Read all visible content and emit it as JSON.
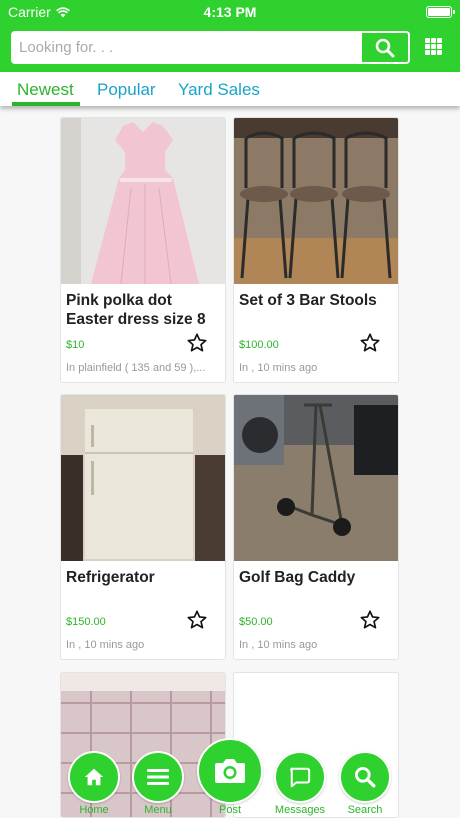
{
  "status_bar": {
    "carrier": "Carrier",
    "time": "4:13 PM"
  },
  "search": {
    "placeholder": "Looking for. . ."
  },
  "tabs": [
    {
      "label": "Newest",
      "active": true
    },
    {
      "label": "Popular",
      "active": false
    },
    {
      "label": "Yard Sales",
      "active": false
    }
  ],
  "listings": [
    {
      "title": "Pink polka dot Easter dress size 8",
      "price": "$10",
      "location": "In plainfield ( 135 and 59 ),..."
    },
    {
      "title": "Set of 3 Bar Stools",
      "price": "$100.00",
      "location": "In , 10 mins ago"
    },
    {
      "title": "Refrigerator",
      "price": "$150.00",
      "location": "In , 10 mins ago"
    },
    {
      "title": "Golf Bag Caddy",
      "price": "$50.00",
      "location": "In , 10 mins ago"
    }
  ],
  "bottom_nav": {
    "home": "Home",
    "menu": "Menu",
    "post": "Post",
    "messages": "Messages",
    "search": "Search"
  },
  "colors": {
    "brand_green": "#2ed12e",
    "tab_blue": "#1aa3c8",
    "price_green": "#2cb52c"
  },
  "icons": [
    "wifi-icon",
    "battery-icon",
    "search-icon",
    "grid-view-icon",
    "star-outline-icon",
    "home-icon",
    "menu-icon",
    "camera-icon",
    "chat-icon"
  ]
}
